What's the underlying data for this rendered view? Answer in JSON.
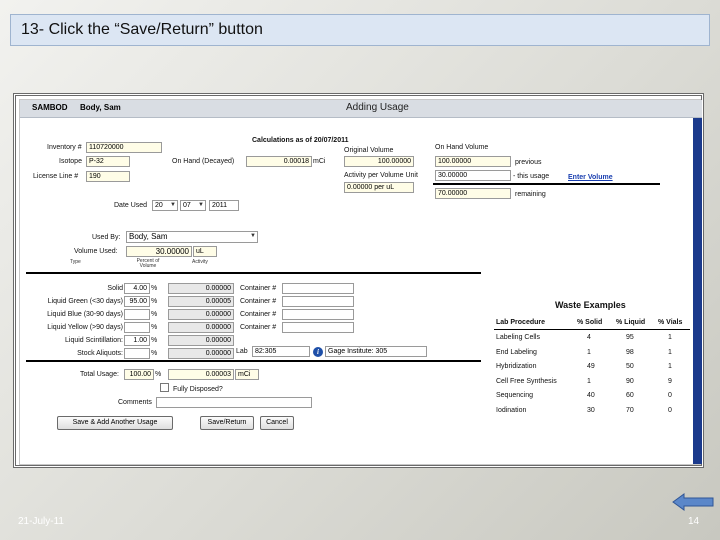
{
  "slide": {
    "title": "13- Click the “Save/Return” button",
    "date": "21-July-11",
    "page_number": "14",
    "back_icon": "left-arrow-icon"
  },
  "app": {
    "header_id": "SAMBOD",
    "header_name": "Body, Sam",
    "header_title": "Adding Usage"
  },
  "form": {
    "inventory_label": "Inventory #",
    "inventory_value": "110720000",
    "isotope_label": "Isotope",
    "isotope_value": "P-32",
    "license_label": "License Line #",
    "license_value": "190",
    "calc_title": "Calculations as of 20/07/2011",
    "on_hand_decayed_label": "On Hand (Decayed)",
    "on_hand_decayed_value": "0.00018",
    "on_hand_decayed_unit": "mCi",
    "original_volume_label": "Original Volume",
    "original_volume_value": "100.00000",
    "activity_per_volume_label": "Activity per Volume Unit",
    "activity_per_volume_value": "0.00000 per uL",
    "on_hand_volume_label": "On Hand Volume",
    "previous_value": "100.00000",
    "previous_label": "previous",
    "this_usage_value": "30.00000",
    "this_usage_label": "- this usage",
    "enter_volume_link": "Enter Volume",
    "remaining_value": "70.00000",
    "remaining_label": "remaining",
    "date_used_label": "Date Used",
    "date_day": "20",
    "date_month": "07",
    "date_year": "2011",
    "used_by_label": "Used By:",
    "used_by_value": "Body, Sam",
    "volume_used_label": "Volume Used:",
    "volume_used_value": "30.00000",
    "volume_used_unit": "uL",
    "col_type": "Type",
    "col_percent": "Percent of Volume",
    "col_activity": "Activity",
    "waste_rows": [
      {
        "label": "Solid",
        "percent": "4.00",
        "activity": "0.00000",
        "container_label": "Container #",
        "container": ""
      },
      {
        "label": "Liquid Green (<30 days)",
        "percent": "95.00",
        "activity": "0.00005",
        "container_label": "Container #",
        "container": ""
      },
      {
        "label": "Liquid Blue (30-90 days)",
        "percent": "",
        "activity": "0.00000",
        "container_label": "Container #",
        "container": ""
      },
      {
        "label": "Liquid Yellow (>90 days)",
        "percent": "",
        "activity": "0.00000",
        "container_label": "Container #",
        "container": ""
      },
      {
        "label": "Liquid Scintillation:",
        "percent": "1.00",
        "activity": "0.00000",
        "container_label": "",
        "container": ""
      },
      {
        "label": "Stock Aliquots:",
        "percent": "",
        "activity": "0.00000",
        "container_label": "",
        "container": ""
      }
    ],
    "percent_sign": "%",
    "lab_label": "Lab",
    "lab_value": "82:305",
    "info_icon": "info-icon",
    "gage_value": "Gage Institute:  305",
    "total_usage_label": "Total Usage:",
    "total_usage_percent": "100.00",
    "total_usage_activity": "0.00003",
    "total_usage_unit": "mCi",
    "fully_disposed_label": "Fully Disposed?",
    "comments_label": "Comments",
    "comments_value": "",
    "btn_save_add": "Save & Add Another Usage",
    "btn_save_return": "Save/Return",
    "btn_cancel": "Cancel"
  },
  "waste_examples": {
    "title": "Waste Examples",
    "headers": [
      "Lab Procedure",
      "% Solid",
      "% Liquid",
      "% Vials"
    ],
    "rows": [
      [
        "Labeling Cells",
        "4",
        "95",
        "1"
      ],
      [
        "End Labeling",
        "1",
        "98",
        "1"
      ],
      [
        "Hybridization",
        "49",
        "50",
        "1"
      ],
      [
        "Cell Free Synthesis",
        "1",
        "90",
        "9"
      ],
      [
        "Sequencing",
        "40",
        "60",
        "0"
      ],
      [
        "Iodination",
        "30",
        "70",
        "0"
      ]
    ]
  },
  "colors": {
    "field_bg": "#fffde7",
    "link": "#1a3fb0",
    "scrollbar": "#1b3a8c"
  }
}
